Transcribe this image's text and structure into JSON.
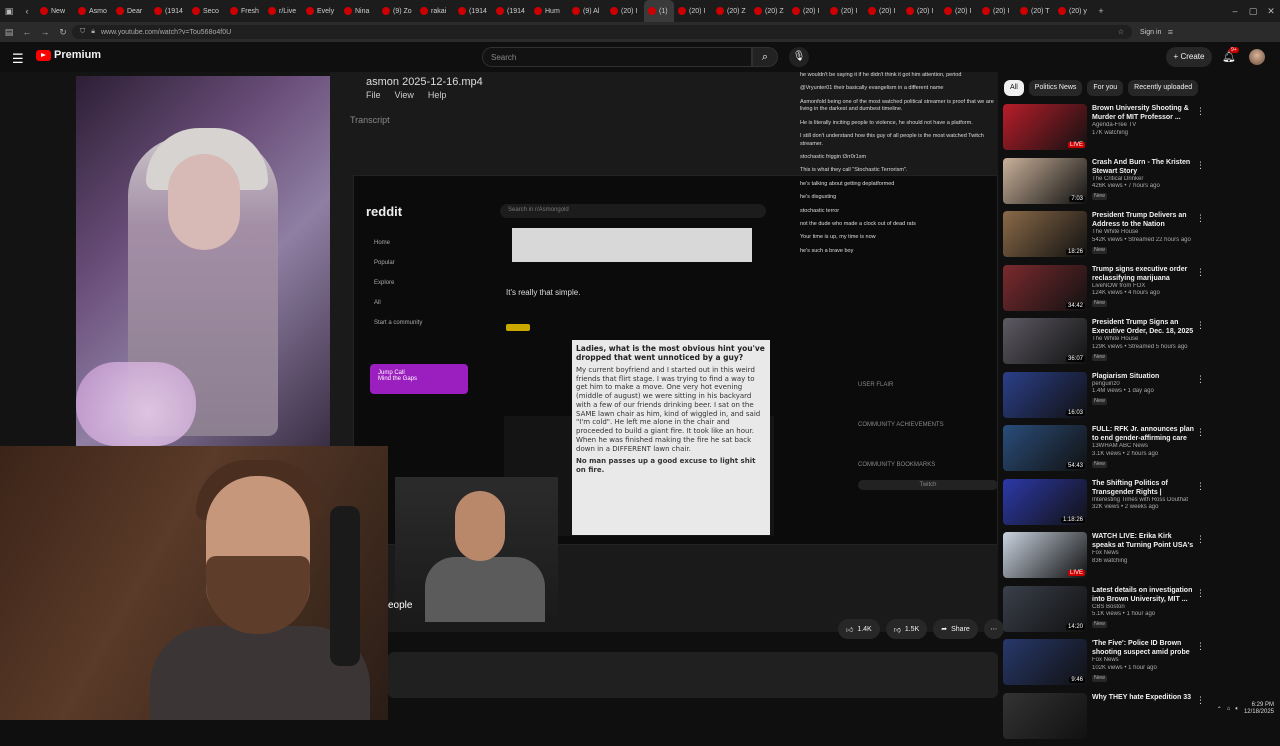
{
  "browser": {
    "tabs": [
      {
        "label": "New",
        "active": false
      },
      {
        "label": "Asmo",
        "active": false
      },
      {
        "label": "Dear",
        "active": false
      },
      {
        "label": "(1914",
        "active": false
      },
      {
        "label": "Seco",
        "active": false
      },
      {
        "label": "Fresh",
        "active": false
      },
      {
        "label": "r/Live",
        "active": false
      },
      {
        "label": "Evely",
        "active": false
      },
      {
        "label": "Nina",
        "active": false
      },
      {
        "label": "(9) Zo",
        "active": false
      },
      {
        "label": "rakai",
        "active": false
      },
      {
        "label": "(1914",
        "active": false
      },
      {
        "label": "(1914",
        "active": false
      },
      {
        "label": "Hum",
        "active": false
      },
      {
        "label": "(9) Al",
        "active": false
      },
      {
        "label": "(20) I",
        "active": false
      },
      {
        "label": "(1)",
        "active": true
      },
      {
        "label": "(20) I",
        "active": false
      },
      {
        "label": "(20) Z",
        "active": false
      },
      {
        "label": "(20) Z",
        "active": false
      },
      {
        "label": "(20) I",
        "active": false
      },
      {
        "label": "(20) I",
        "active": false
      },
      {
        "label": "(20) I",
        "active": false
      },
      {
        "label": "(20) I",
        "active": false
      },
      {
        "label": "(20) I",
        "active": false
      },
      {
        "label": "(20) I",
        "active": false
      },
      {
        "label": "(20) T",
        "active": false
      },
      {
        "label": "(20) y",
        "active": false
      }
    ],
    "new_tab": "+",
    "url": "www.youtube.com/watch?v=Tou568o4f0U",
    "sign_in": "Sign in"
  },
  "header": {
    "logo_text": "Premium",
    "search_placeholder": "Search",
    "create_label": "Create",
    "notif_count": "9+"
  },
  "video": {
    "file_title": "asmon 2025-12-16.mp4",
    "menu": [
      "File",
      "View",
      "Help"
    ],
    "transcript_label": "Transcript",
    "reddit": {
      "logo": "reddit",
      "search": "Search in r/Asmongold",
      "nav": [
        "Home",
        "Popular",
        "Explore",
        "All",
        "Start a community"
      ],
      "card_title": "Jump Call",
      "card_sub": "Mind the Gaps",
      "post_title": "It's really that simple."
    },
    "story_heading": "Ladies, what is the most obvious hint you've dropped that went unnoticed by a guy?",
    "story_body": "My current boyfriend and I started out in this weird friends that flirt stage. I was trying to find a way to get him to make a move. One very hot evening (middle of august) we were sitting in his backyard with a few of our friends drinking beer. I sat on the SAME lawn chair as him, kind of wiggled in, and said \"I'm cold\". He left me alone in the chair and proceeded to build a giant fire. It took like an hour. When he was finished making the fire he sat back down in a DIFFERENT lawn chair.",
    "story_footer": "No man passes up a good excuse to light shit on fire.",
    "chat_messages": [
      "he wouldn't be saying it if he didn't think it got him attention, period",
      "@Vryunter01 their basically evangelism in a different name",
      "Asmonfold being one of the most watched political streamer is proof that we are living in the darkest and dumbest timeline.",
      "He is literally inciting people to violence, he should not have a platform.",
      "I still don't understand how this guy of all people is the most watched Twitch streamer.",
      "stochastic friggin t3rr0r1sm",
      "This is what they call \"Stochastic Terrorism\".",
      "he's talking about getting deplatformed",
      "he's disgusting",
      "stochastic terror",
      "not the dude who made a clock out of dead rats",
      "Your time is up, my time is now",
      "he's such a brave boy"
    ],
    "sidebar_labels": [
      "USER FLAIR",
      "COMMUNITY ACHIEVEMENTS",
      "COMMUNITY BOOKMARKS",
      "Twitch"
    ],
    "title_fragment": "eople"
  },
  "actions": {
    "likes": "1.4K",
    "dislikes": "1.5K",
    "share": "Share"
  },
  "chips": [
    {
      "label": "All",
      "active": true
    },
    {
      "label": "Politics News",
      "active": false
    },
    {
      "label": "For you",
      "active": false
    },
    {
      "label": "Recently uploaded",
      "active": false
    }
  ],
  "recommendations": [
    {
      "title": "Brown University Shooting & Murder of MIT Professor ...",
      "channel": "Agenda-Free TV",
      "views": "17K watching",
      "duration": "LIVE",
      "live": true,
      "badge": "",
      "thumb": "#b81d2a"
    },
    {
      "title": "Crash And Burn - The Kristen Stewart Story",
      "channel": "The Critical Drinker",
      "views": "426K views • 7 hours ago",
      "duration": "7:03",
      "live": false,
      "badge": "New",
      "thumb": "#c9b19a"
    },
    {
      "title": "President Trump Delivers an Address to the Nation",
      "channel": "The White House",
      "views": "542K views • Streamed 22 hours ago",
      "duration": "18:26",
      "live": false,
      "badge": "New",
      "thumb": "#8a6a48"
    },
    {
      "title": "Trump signs executive order reclassifying marijuana",
      "channel": "LiveNOW from FOX",
      "views": "124K views • 4 hours ago",
      "duration": "34:42",
      "live": false,
      "badge": "New",
      "thumb": "#7b2a2e"
    },
    {
      "title": "President Trump Signs an Executive Order, Dec. 18, 2025",
      "channel": "The White House",
      "views": "129K views • Streamed 5 hours ago",
      "duration": "36:07",
      "live": false,
      "badge": "New",
      "thumb": "#5d5a63"
    },
    {
      "title": "Plagiarism Situation",
      "channel": "penguinz0",
      "views": "1.4M views • 1 day ago",
      "duration": "16:03",
      "live": false,
      "badge": "New",
      "thumb": "#2b3f8a"
    },
    {
      "title": "FULL: RFK Jr. announces plan to end gender-affirming care f...",
      "channel": "13WHAM ABC News",
      "views": "3.1K views • 2 hours ago",
      "duration": "54:43",
      "live": false,
      "badge": "New",
      "thumb": "#2a4d7a"
    },
    {
      "title": "The Shifting Politics of Transgender Rights | Interesti...",
      "channel": "Interesting Times with Ross Douthat",
      "views": "32K views • 2 weeks ago",
      "duration": "1:18:26",
      "live": false,
      "badge": "",
      "thumb": "#2d39a8"
    },
    {
      "title": "WATCH LIVE: Erika Kirk speaks at Turning Point USA's annual ...",
      "channel": "Fox News",
      "views": "836 watching",
      "duration": "LIVE",
      "live": true,
      "badge": "",
      "thumb": "#c9d3e0"
    },
    {
      "title": "Latest details on investigation into Brown University, MIT ...",
      "channel": "CBS Boston",
      "views": "5.1K views • 1 hour ago",
      "duration": "14:20",
      "live": false,
      "badge": "New",
      "thumb": "#3a3f4a"
    },
    {
      "title": "'The Five': Police ID Brown shooting suspect amid probe ...",
      "channel": "Fox News",
      "views": "102K views • 1 hour ago",
      "duration": "9:46",
      "live": false,
      "badge": "New",
      "thumb": "#27386b"
    },
    {
      "title": "Why THEY hate Expedition 33",
      "channel": "",
      "views": "",
      "duration": "",
      "live": false,
      "badge": "",
      "thumb": "#333"
    }
  ],
  "taskbar": {
    "time": "6:29 PM",
    "date": "12/18/2025"
  },
  "colors": {
    "yt_red": "#ff0000",
    "live_red": "#cc0000",
    "page_bg": "#0f0f0f"
  }
}
